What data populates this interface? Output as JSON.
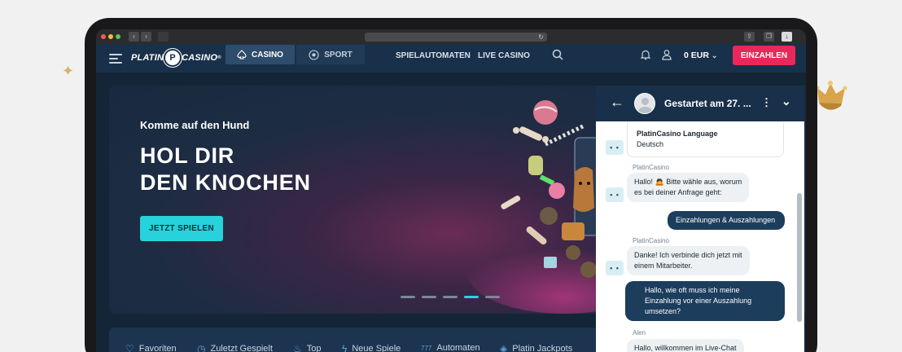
{
  "colors": {
    "accent_cyan": "#27d2dc",
    "deposit_pink": "#e8285a",
    "navy": "#19304a",
    "chat_out_bubble": "#1d3d5d"
  },
  "header": {
    "logo_left": "PLATIN",
    "logo_badge": "P",
    "logo_right": "CASINO",
    "logo_tm": "®",
    "tab_casino": "CASINO",
    "tab_sport": "SPORT",
    "link_slots": "SPIELAUTOMATEN",
    "link_live": "LIVE CASINO",
    "balance": "0 EUR",
    "balance_caret": "⌄",
    "deposit": "EINZAHLEN"
  },
  "hero": {
    "subtitle": "Komme auf den Hund",
    "title_line1": "HOL DIR",
    "title_line2": "DEN KNOCHEN",
    "cta": "JETZT SPIELEN",
    "slides_total": 5,
    "active_slide": 4
  },
  "categories": [
    {
      "icon": "heart-icon",
      "glyph": "♡",
      "label": "Favoriten"
    },
    {
      "icon": "clock-icon",
      "glyph": "◷",
      "label": "Zuletzt Gespielt"
    },
    {
      "icon": "flame-icon",
      "glyph": "♨",
      "label": "Top"
    },
    {
      "icon": "bolt-icon",
      "glyph": "ϟ",
      "label": "Neue Spiele"
    },
    {
      "icon": "slot-777-icon",
      "glyph": "777",
      "label": "Automaten"
    },
    {
      "icon": "diamond-icon",
      "glyph": "◈",
      "label": "Platin Jackpots"
    }
  ],
  "chat": {
    "back": "←",
    "title": "Gestartet am 27. ...",
    "more": "⋮",
    "collapse": "⌄",
    "bot_icon": "• •",
    "lang_card_title": "PlatinCasino Language",
    "lang_card_value": "Deutsch",
    "messages": [
      {
        "sender": "PlatinCasino",
        "text_line1": "Hallo! 🙇 Bitte wähle aus, worum",
        "text_line2": "es bei deiner Anfrage geht:"
      },
      {
        "text": "Einzahlungen & Auszahlungen"
      },
      {
        "sender": "PlatinCasino",
        "text_line1": "Danke! Ich verbinde dich jetzt mit",
        "text_line2": "einem Mitarbeiter."
      },
      {
        "text_line1": "Hallo, wie oft muss ich meine",
        "text_line2": "Einzahlung vor einer Auszahlung",
        "text_line3": "umsetzen?"
      },
      {
        "sender": "Alen",
        "text": "Hallo, willkommen im Live-Chat"
      }
    ]
  }
}
